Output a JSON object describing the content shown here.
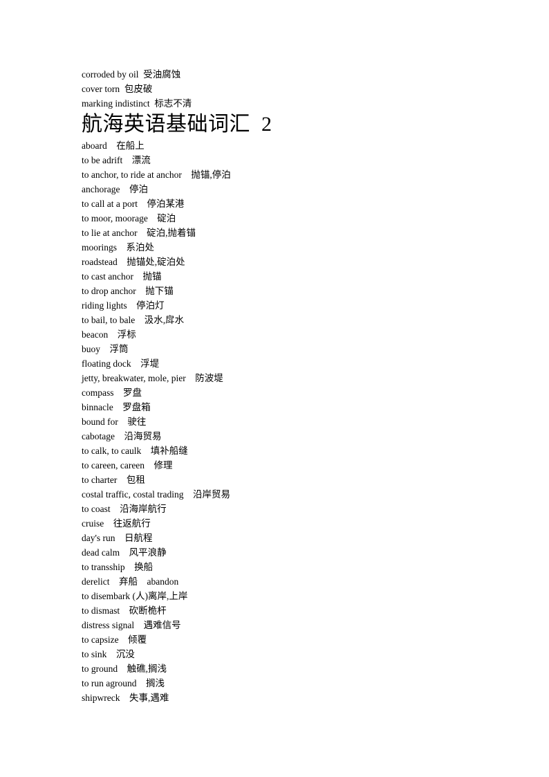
{
  "document": {
    "title": "航海英语基础词汇  2",
    "page_background": "#ffffff",
    "text_color": "#000000"
  },
  "pre_title_lines": [
    "corroded by oil  受油腐蚀",
    "cover torn  包皮破",
    "marking indistinct  标志不清"
  ],
  "vocabulary": [
    "aboard    在船上",
    "to be adrift    漂流",
    "to anchor, to ride at anchor    抛锚,停泊",
    "anchorage    停泊",
    "to call at a port    停泊某港",
    "to moor, moorage    碇泊",
    "to lie at anchor    碇泊,抛着锚",
    "moorings    系泊处",
    "roadstead    抛锚处,碇泊处",
    "to cast anchor    抛锚",
    "to drop anchor    抛下锚",
    "riding lights    停泊灯",
    "to bail, to bale    汲水,戽水",
    "beacon    浮标",
    "buoy    浮筒",
    "floating dock    浮堤",
    "jetty, breakwater, mole, pier    防波堤",
    "compass    罗盘",
    "binnacle    罗盘箱",
    "bound for    驶往",
    "cabotage    沿海贸易",
    "to calk, to caulk    填补船缝",
    "to careen, careen    修理",
    "to charter    包租",
    "costal traffic, costal trading    沿岸贸易",
    "to coast    沿海岸航行",
    "cruise    往返航行",
    "day's run    日航程",
    "dead calm    风平浪静",
    "to transship    换船",
    "derelict    弃船    abandon",
    "to disembark (人)离岸,上岸",
    "to dismast    砍断桅杆",
    "distress signal    遇难信号",
    "to capsize    倾覆",
    "to sink    沉没",
    "to ground    触礁,搁浅",
    "to run aground    搁浅",
    "shipwreck    失事,遇难"
  ]
}
